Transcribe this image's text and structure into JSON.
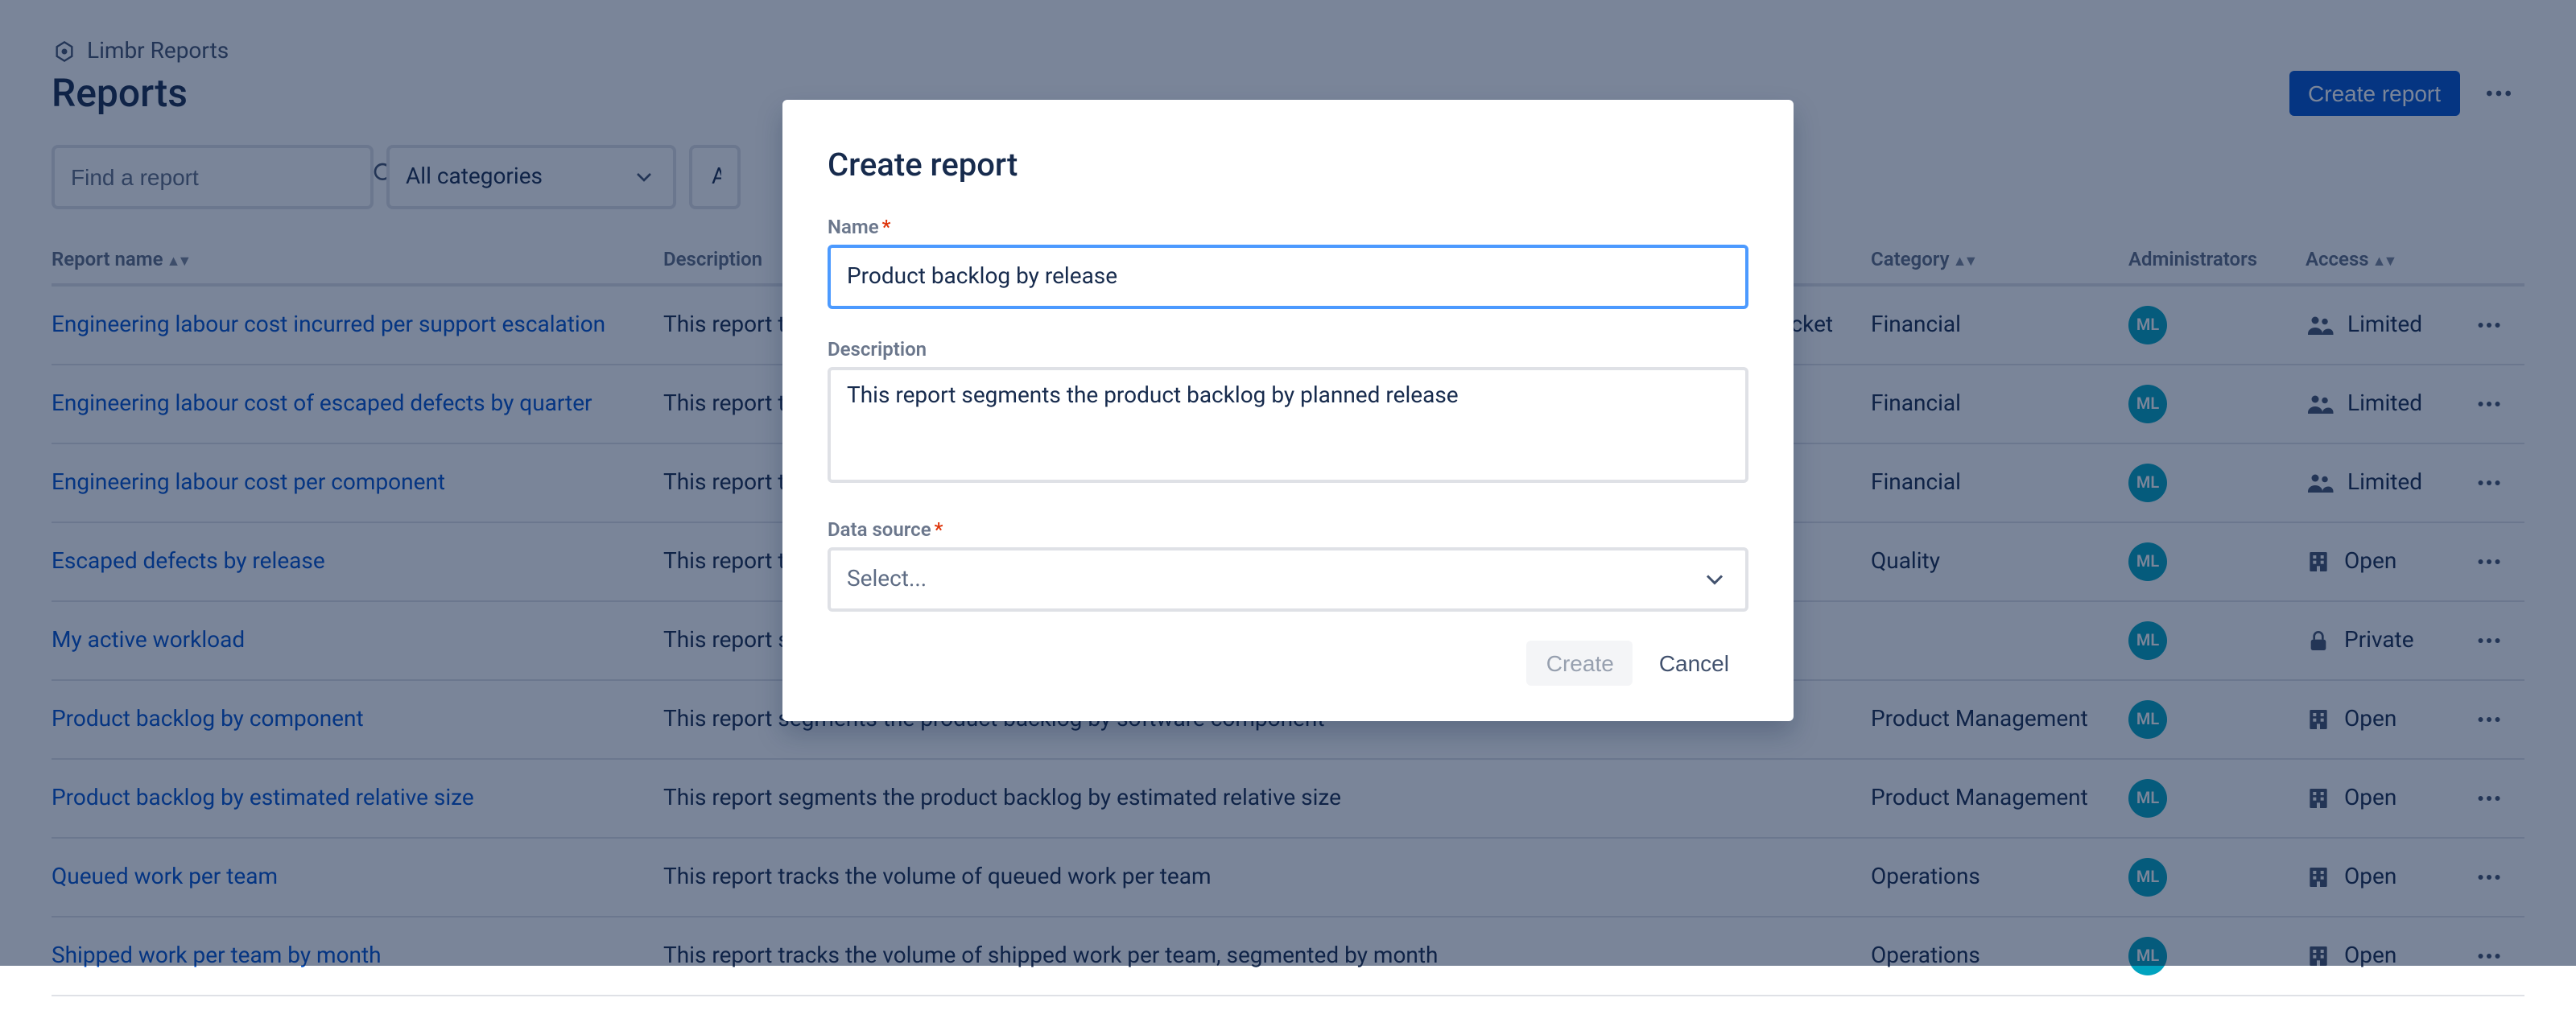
{
  "brand": {
    "name": "Limbr Reports"
  },
  "page": {
    "title": "Reports"
  },
  "actions": {
    "create_report": "Create report"
  },
  "filters": {
    "search_placeholder": "Find a report",
    "category_label": "All categories",
    "access_label_truncated": "All a"
  },
  "table": {
    "headers": {
      "name": "Report name",
      "description": "Description",
      "category": "Category",
      "administrators": "Administrators",
      "access": "Access"
    },
    "rows": [
      {
        "name": "Engineering labour cost incurred per support escalation",
        "description": "This report tracks the engineering hours devoted to remediating support escalations, segmented per escalation ticket",
        "category": "Financial",
        "admin": "ML",
        "access": "Limited",
        "access_icon": "group"
      },
      {
        "name": "Engineering labour cost of escaped defects by quarter",
        "description": "This report tracks the engineering cost of remediating high-severity escaped defects in each product, by quarter",
        "category": "Financial",
        "admin": "ML",
        "access": "Limited",
        "access_icon": "group"
      },
      {
        "name": "Engineering labour cost per component",
        "description": "This report tracks the engineering labour cost devoted to each software component",
        "category": "Financial",
        "admin": "ML",
        "access": "Limited",
        "access_icon": "group"
      },
      {
        "name": "Escaped defects by release",
        "description": "This report tracks the number of escaped defects per release",
        "category": "Quality",
        "admin": "ML",
        "access": "Open",
        "access_icon": "building"
      },
      {
        "name": "My active workload",
        "description": "This report shows my active work items",
        "category": "",
        "admin": "ML",
        "access": "Private",
        "access_icon": "lock"
      },
      {
        "name": "Product backlog by component",
        "description": "This report segments the product backlog by software component",
        "category": "Product Management",
        "admin": "ML",
        "access": "Open",
        "access_icon": "building"
      },
      {
        "name": "Product backlog by estimated relative size",
        "description": "This report segments the product backlog by estimated relative size",
        "category": "Product Management",
        "admin": "ML",
        "access": "Open",
        "access_icon": "building"
      },
      {
        "name": "Queued work per team",
        "description": "This report tracks the volume of queued work per team",
        "category": "Operations",
        "admin": "ML",
        "access": "Open",
        "access_icon": "building"
      },
      {
        "name": "Shipped work per team by month",
        "description": "This report tracks the volume of shipped work per team, segmented by month",
        "category": "Operations",
        "admin": "ML",
        "access": "Open",
        "access_icon": "building"
      }
    ]
  },
  "modal": {
    "title": "Create report",
    "name_label": "Name",
    "name_value": "Product backlog by release",
    "description_label": "Description",
    "description_value": "This report segments the product backlog by planned release",
    "datasource_label": "Data source",
    "datasource_placeholder": "Select...",
    "create_label": "Create",
    "cancel_label": "Cancel"
  },
  "icons": {
    "group": "group-icon",
    "building": "building-icon",
    "lock": "lock-icon"
  }
}
